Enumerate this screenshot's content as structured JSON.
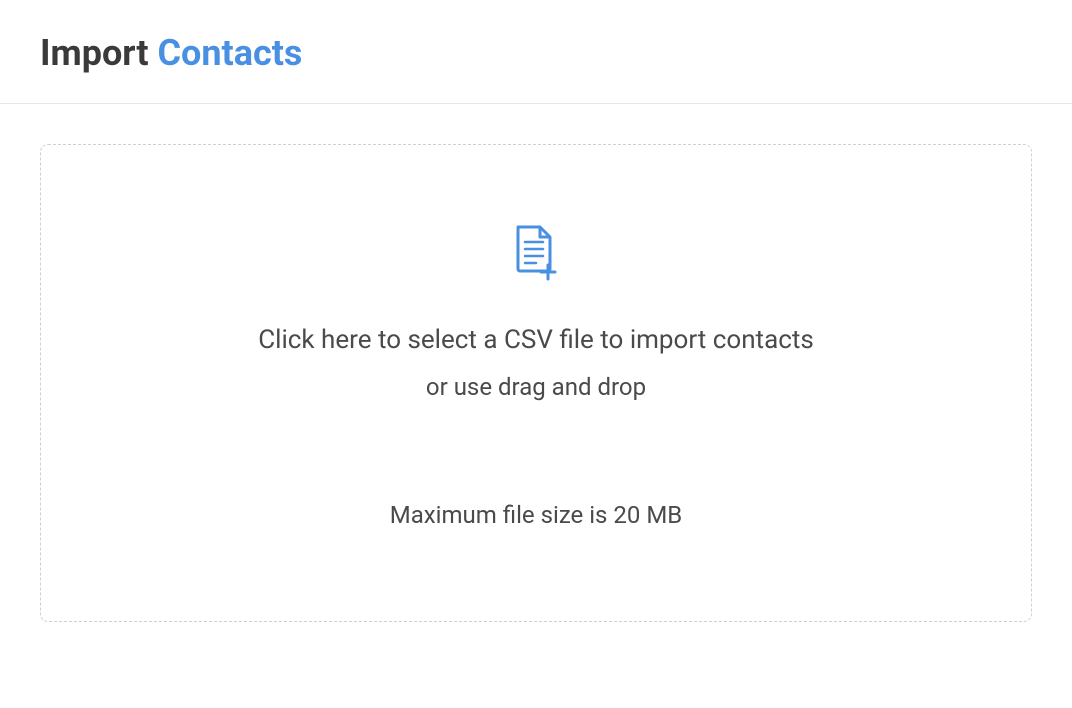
{
  "header": {
    "title_part1": "Import ",
    "title_part2": "Contacts"
  },
  "dropzone": {
    "instruction_primary": "Click here to select a CSV file to import contacts",
    "instruction_secondary": "or use drag and drop",
    "instruction_limit": "Maximum file size is 20 MB",
    "icon_name": "file-add-icon"
  },
  "colors": {
    "accent": "#4a90e2",
    "text_dark": "#3a3a3a",
    "text_body": "#4a4a4a",
    "border": "#cfcfcf"
  }
}
